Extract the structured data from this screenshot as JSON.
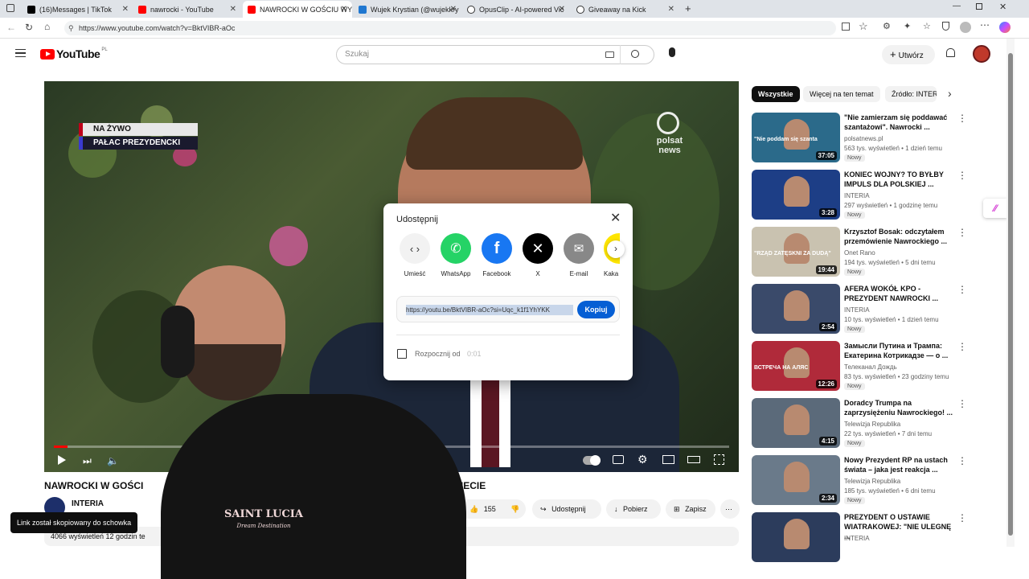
{
  "browser": {
    "tabs": [
      {
        "label": "(16)Messages | TikTok",
        "color": "#000000"
      },
      {
        "label": "nawrocki - YouTube",
        "color": "#ff0000"
      },
      {
        "label": "NAWROCKI W GOŚCIU WY",
        "color": "#ff0000"
      },
      {
        "label": "Wujek Krystian (@wujekkry",
        "color": "#1f77d0"
      },
      {
        "label": "OpusClip - AI-powered Vic",
        "color": "#333333"
      },
      {
        "label": "Giveaway na Kick",
        "color": "#333333"
      }
    ],
    "url": "https://www.youtube.com/watch?v=BktVIBR-aOc"
  },
  "youtube": {
    "logo": "YouTube",
    "region": "PL",
    "search_placeholder": "Szukaj",
    "create_label": "Utwórz"
  },
  "video": {
    "live_label": "NA ŻYWO",
    "location_label": "PAŁAC PREZYDENCKI",
    "broadcaster": "polsat news",
    "progress_fraction": 0.02
  },
  "share_dialog": {
    "title": "Udostępnij",
    "targets": [
      {
        "label": "Umieść",
        "icon": "embed-icon",
        "color": "#f2f2f2"
      },
      {
        "label": "WhatsApp",
        "icon": "whatsapp-icon",
        "color": "#25d366"
      },
      {
        "label": "Facebook",
        "icon": "facebook-icon",
        "color": "#1877f2"
      },
      {
        "label": "X",
        "icon": "x-icon",
        "color": "#000000"
      },
      {
        "label": "E-mail",
        "icon": "email-icon",
        "color": "#888888"
      },
      {
        "label": "Kaka",
        "icon": "kakao-icon",
        "color": "#fee500"
      }
    ],
    "link": "https://youtu.be/BktVIBR-aOc?si=Uqc_k1f1YhYKK",
    "copy_label": "Kopiuj",
    "start_label": "Rozpocznij od",
    "start_time": "0:01"
  },
  "below_video": {
    "title_left": "NAWROCKI W GOŚCI",
    "title_right": "A ŚWIECIE",
    "channel": "INTERIA",
    "stats": "4066 wyświetleń  12 godzin te",
    "likes": "155",
    "share_label": "Udostępnij",
    "download_label": "Pobierz",
    "save_label": "Zapisz"
  },
  "toast": "Link został skopiowany do schowka",
  "overlay": {
    "shirt_line1": "SAINT LUCIA",
    "shirt_line2": "Dream Destination"
  },
  "sidebar": {
    "chips": [
      "Wszystkie",
      "Więcej na ten temat",
      "Źródło: INTER"
    ],
    "recommendations": [
      {
        "title": "\"Nie zamierzam się poddawać szantażowi\". Nawrocki ...",
        "channel": "polsatnews.pl",
        "meta": "563 tys. wyświetleń • 1 dzień temu",
        "badge": "Nowy",
        "duration": "37:05",
        "thumb_caption": "\"Nie poddam się szanta",
        "bg": "#2b6a8a"
      },
      {
        "title": "KONIEC WOJNY? TO BYŁBY IMPULS DLA POLSKIEJ ...",
        "channel": "INTERIA",
        "meta": "297 wyświetleń • 1 godzinę temu",
        "badge": "Nowy",
        "duration": "3:28",
        "thumb_caption": "",
        "bg": "#1d3e86"
      },
      {
        "title": "Krzysztof Bosak: odczytałem przemówienie Nawrockiego ...",
        "channel": "Onet Rano",
        "meta": "194 tys. wyświetleń • 5 dni temu",
        "badge": "Nowy",
        "duration": "19:44",
        "thumb_caption": "\"RZĄD ZATĘSKNI ZA DUDĄ\"",
        "bg": "#c9c2b0"
      },
      {
        "title": "AFERA WOKÓŁ KPO - PREZYDENT NAWROCKI ...",
        "channel": "INTERIA",
        "meta": "10 tys. wyświetleń • 1 dzień temu",
        "badge": "Nowy",
        "duration": "2:54",
        "thumb_caption": "",
        "bg": "#3a4a6a"
      },
      {
        "title": "Замысли Путина и Трампа: Екатерина Котрикадзе — о ...",
        "channel": "Телеканал Дождь",
        "meta": "83 tys. wyświetleń • 23 godziny temu",
        "badge": "Nowy",
        "duration": "12:26",
        "thumb_caption": "ВСТРЕЧА НА АЛЯС",
        "bg": "#b02a3a"
      },
      {
        "title": "Doradcy Trumpa na zaprzysiężeniu Nawrockiego! ...",
        "channel": "Telewizja Republika",
        "meta": "22 tys. wyświetleń • 7 dni temu",
        "badge": "Nowy",
        "duration": "4:15",
        "thumb_caption": "",
        "bg": "#5b6a7a"
      },
      {
        "title": "Nowy Prezydent RP na ustach świata – jaka jest reakcja ...",
        "channel": "Telewizja Republika",
        "meta": "185 tys. wyświetleń • 6 dni temu",
        "badge": "Nowy",
        "duration": "2:34",
        "thumb_caption": "",
        "bg": "#6a7a8a"
      },
      {
        "title": "PREZYDENT O USTAWIE WIATRAKOWEJ: \"NIE ULEGNĘ ...",
        "channel": "INTERIA",
        "meta": "",
        "badge": "",
        "duration": "",
        "thumb_caption": "",
        "bg": "#2c3c5c"
      }
    ]
  }
}
